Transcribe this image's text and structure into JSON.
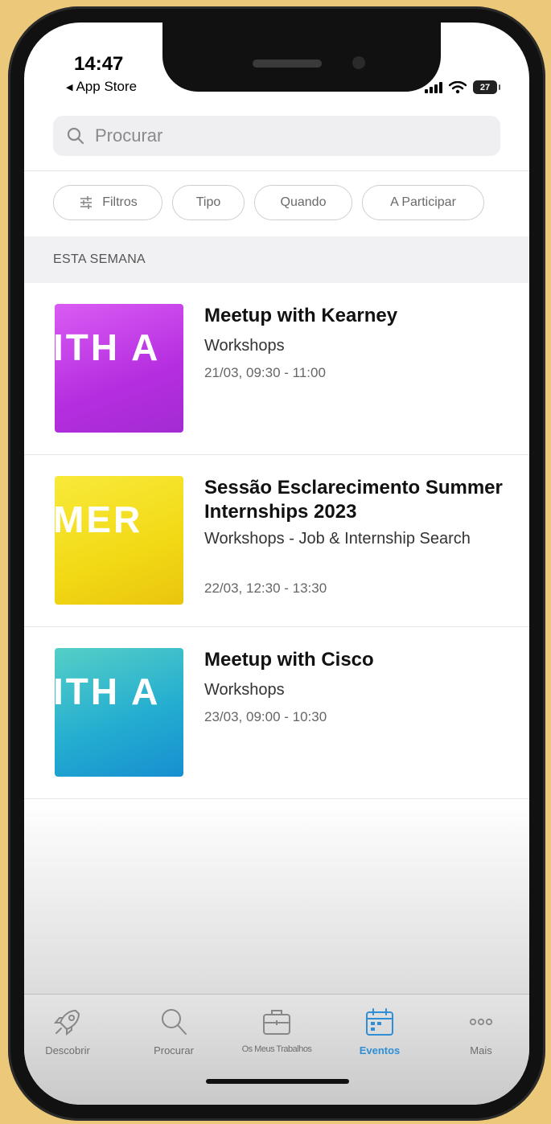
{
  "status_bar": {
    "time": "14:47",
    "back_app": "App Store",
    "battery": "27"
  },
  "search": {
    "placeholder": "Procurar"
  },
  "filters": [
    {
      "label": "Filtros"
    },
    {
      "label": "Tipo"
    },
    {
      "label": "Quando"
    },
    {
      "label": "A Participar"
    }
  ],
  "section_header": "ESTA SEMANA",
  "events": [
    {
      "thumb_text": "ITH A",
      "thumb_colors": [
        "#d246f0",
        "#9b1fc9"
      ],
      "title": "Meetup with Kearney",
      "category": "Workshops",
      "date": "21/03, 09:30 - 11:00"
    },
    {
      "thumb_text": "MER",
      "thumb_colors": [
        "#f7e31e",
        "#e6c40c"
      ],
      "title": "Sessão Esclarecimento Summer Internships 2023",
      "category": "Workshops - Job & Internship Search",
      "date": "22/03, 12:30 - 13:30"
    },
    {
      "thumb_text": "ITH A",
      "thumb_colors": [
        "#3fc2c7",
        "#1496cf"
      ],
      "title": "Meetup with Cisco",
      "category": "Workshops",
      "date": "23/03, 09:00 - 10:30"
    }
  ],
  "tabbar": [
    {
      "label": "Descobrir",
      "icon": "rocket-icon",
      "active": false
    },
    {
      "label": "Procurar",
      "icon": "search-icon",
      "active": false
    },
    {
      "label": "Os Meus Trabalhos",
      "icon": "briefcase-icon",
      "active": false
    },
    {
      "label": "Eventos",
      "icon": "calendar-icon",
      "active": true
    },
    {
      "label": "Mais",
      "icon": "more-icon",
      "active": false
    }
  ],
  "accent_color": "#2f8fd6"
}
